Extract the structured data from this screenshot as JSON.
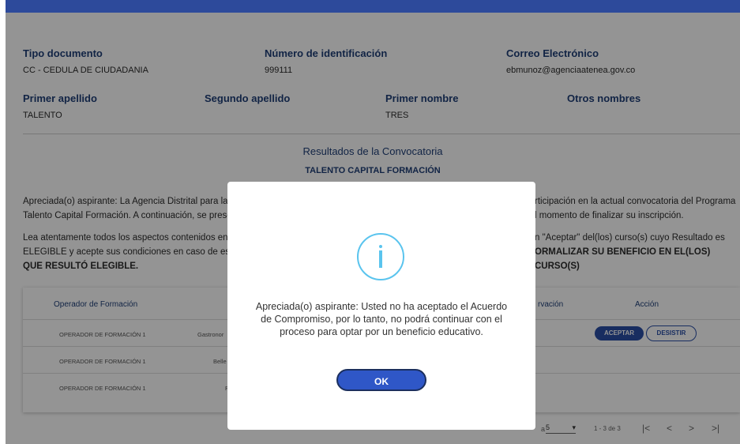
{
  "profile": {
    "tipo_documento": {
      "label": "Tipo documento",
      "value": "CC - CEDULA DE CIUDADANIA"
    },
    "numero_identificacion": {
      "label": "Número de identificación",
      "value": "999111"
    },
    "correo": {
      "label": "Correo Electrónico",
      "value": "ebmunoz@agenciaatenea.gov.co"
    },
    "primer_apellido": {
      "label": "Primer apellido",
      "value": "TALENTO"
    },
    "segundo_apellido": {
      "label": "Segundo apellido",
      "value": ""
    },
    "primer_nombre": {
      "label": "Primer nombre",
      "value": "TRES"
    },
    "otros_nombres": {
      "label": "Otros nombres",
      "value": ""
    }
  },
  "results": {
    "title": "Resultados de la Convocatoria",
    "subtitle": "TALENTO CAPITAL FORMACIÓN",
    "para1_line1_left": "Apreciada(o) aspirante: La Agencia Distrital para la",
    "para1_line1_right": "rticipación en la actual convocatoria del Programa",
    "para1_line2_left": "Talento Capital Formación. A continuación, se prese",
    "para1_line2_right": "l momento de finalizar su inscripción.",
    "para2_line1_left": "Lea atentamente todos los aspectos contenidos en",
    "para2_line1_right": "n \"Aceptar\" del(los) curso(s) cuyo Resultado es",
    "para2_line2_left": "ELEGIBLE y acepte sus condiciones en caso de esta",
    "para2_line2_right": "ORMALIZAR SU BENEFICIO EN EL(LOS) CURSO(S)",
    "para2_line3": "QUE RESULTÓ ELEGIBLE."
  },
  "table": {
    "headers": {
      "operador": "Operador de Formación",
      "observacion": "rvación",
      "accion": "Acción"
    },
    "rows": [
      {
        "operador": "OPERADOR DE FORMACIÓN 1",
        "curso": "Gastronor"
      },
      {
        "operador": "OPERADOR DE FORMACIÓN 1",
        "curso": "Belle"
      },
      {
        "operador": "OPERADOR DE FORMACIÓN 1",
        "curso": "P"
      }
    ],
    "accept_label": "ACEPTAR",
    "desist_label": "DESISTIR"
  },
  "pagination": {
    "per_page_label": "a",
    "per_page_value": "5",
    "range": "1 - 3 de 3",
    "first": "|<",
    "prev": "<",
    "next": ">",
    "last": ">|"
  },
  "modal": {
    "icon": "info-icon",
    "message": "Apreciada(o) aspirante: Usted no ha aceptado el Acuerdo de Compromiso, por lo tanto, no podrá continuar con el proceso para optar por un beneficio educativo.",
    "ok_label": "OK"
  },
  "colors": {
    "header_bar": "#2d4a9b",
    "label_text": "#1f3f78",
    "accent_button": "#2f57c7",
    "info_icon": "#5ac4ee"
  }
}
